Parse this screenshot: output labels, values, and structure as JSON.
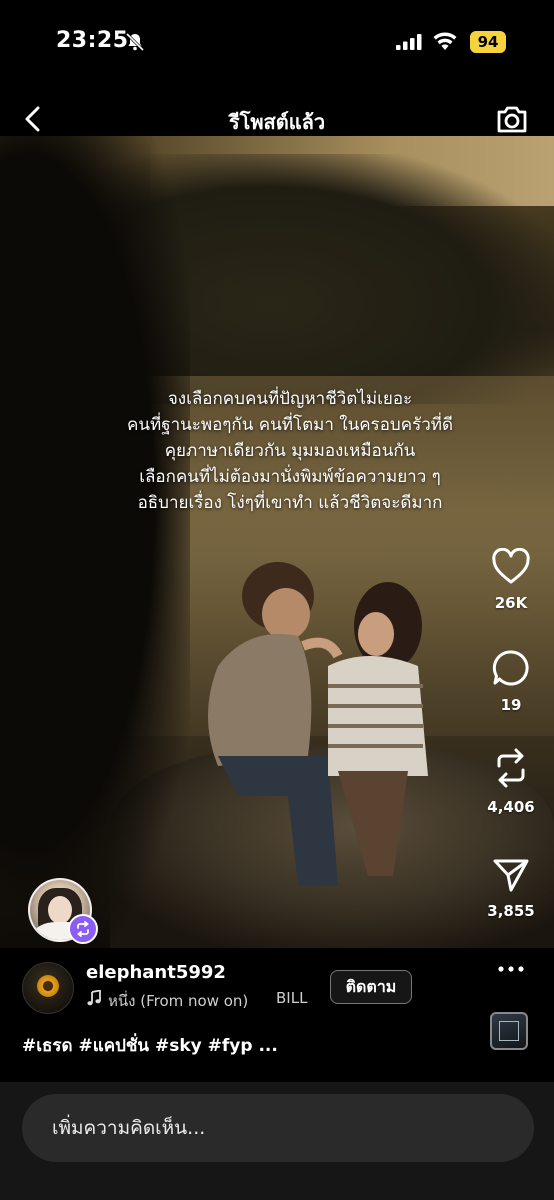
{
  "status_bar": {
    "time": "23:25",
    "battery": "94",
    "icons": [
      "bell-slash-icon",
      "signal-icon",
      "wifi-icon"
    ]
  },
  "header": {
    "title": "รีโพสต์แล้ว",
    "icons": [
      "back-icon",
      "camera-icon"
    ]
  },
  "post": {
    "overlay_lines": [
      "จงเลือกคบคนที่ปัญหาชีวิตไม่เยอะ",
      "คนที่ฐานะพอๆกัน คนที่โตมา ในครอบครัวที่ดี",
      "คุยภาษาเดียวกัน มุมมองเหมือนกัน",
      "เลือกคนที่ไม่ต้องมานั่งพิมพ์ข้อความยาว ๆ",
      "อธิบายเรื่อง โง่ๆที่เขาทำ แล้วชีวิตจะดีมาก"
    ],
    "actions": {
      "likes": "26K",
      "comments": "19",
      "reposts": "4,406",
      "shares": "3,855"
    },
    "author": "elephant5992",
    "music_title": "หนึ่ง (From now on)",
    "music_artist": "BILL",
    "follow_label": "ติดตาม",
    "hashtags": "#เธรด #แคปชั่น #sky #fyp ..."
  },
  "comment": {
    "placeholder": "เพิ่มความคิดเห็น..."
  },
  "colors": {
    "battery": "#f6d33c",
    "repost_badge": "#8b5cf6",
    "background": "#000000",
    "comment_bar": "#161616"
  }
}
